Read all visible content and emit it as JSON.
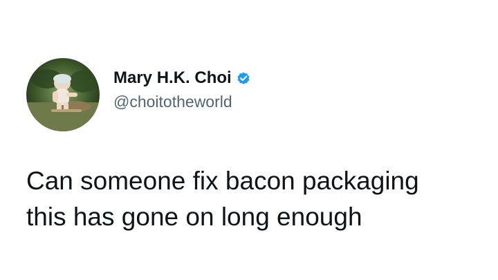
{
  "tweet": {
    "display_name": "Mary H.K. Choi",
    "handle": "@choitotheworld",
    "text": "Can someone fix bacon packaging\nthis has gone on long enough"
  },
  "icons": {
    "verified": "verified-badge-icon",
    "avatar": "profile-photo"
  },
  "colors": {
    "name": "#0f1419",
    "handle": "#536471",
    "verified": "#1d9bf0",
    "background": "#ffffff"
  }
}
